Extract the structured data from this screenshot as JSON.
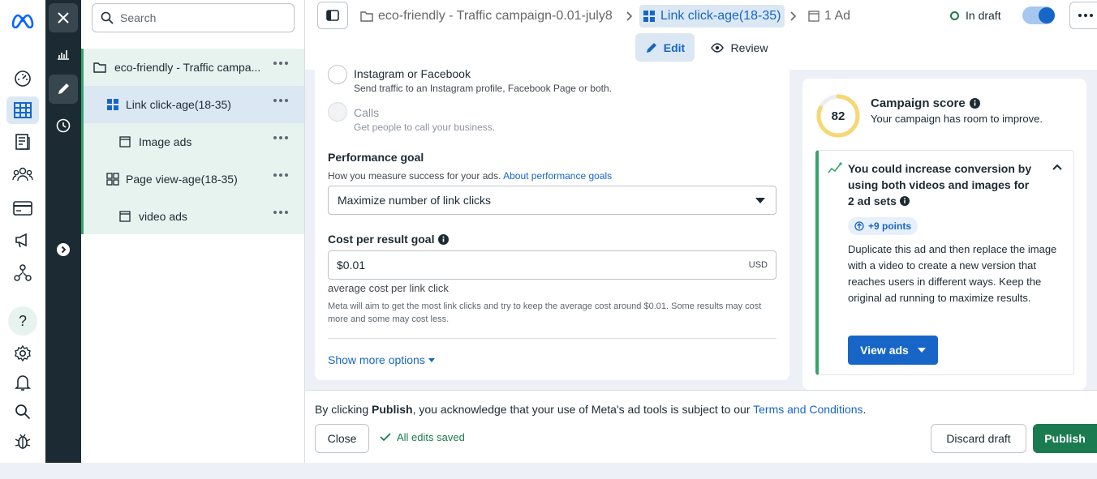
{
  "sidebar_search": {
    "placeholder": "Search"
  },
  "tree": {
    "campaign": "eco-friendly - Traffic campa...",
    "adset1": "Link click-age(18-35)",
    "ad1": "Image ads",
    "adset2": "Page view-age(18-35)",
    "ad2": "video ads"
  },
  "breadcrumb": {
    "campaign": "eco-friendly - Traffic campaign-0.01-july8",
    "adset": "Link click-age(18-35)",
    "ads": "1 Ad"
  },
  "status": {
    "label": "In draft"
  },
  "tabs": {
    "edit": "Edit",
    "review": "Review"
  },
  "form": {
    "option_ig_fb": {
      "title": "Instagram or Facebook",
      "desc": "Send traffic to an Instagram profile, Facebook Page or both."
    },
    "option_calls": {
      "title": "Calls",
      "desc": "Get people to call your business."
    },
    "perf_goal": {
      "title": "Performance goal",
      "desc": "How you measure success for your ads.",
      "link": "About performance goals",
      "value": "Maximize number of link clicks"
    },
    "cost_goal": {
      "title": "Cost per result goal",
      "value": "$0.01",
      "currency": "USD",
      "sub": "average cost per link click",
      "note": "Meta will aim to get the most link clicks and try to keep the average cost around $0.01. Some results may cost more and some may cost less."
    },
    "show_more": "Show more options"
  },
  "score": {
    "value": "82",
    "value_fraction": 0.82,
    "title": "Campaign score",
    "subtitle": "Your campaign has room to improve.",
    "rec_title": "You could increase conversion by using both videos and images for 2 ad sets",
    "points": "+9 points",
    "rec_body": "Duplicate this ad and then replace the image with a video to create a new version that reaches users in different ways. Keep the original ad running to maximize results.",
    "view_ads": "View ads"
  },
  "footer": {
    "pre": "By clicking ",
    "bold": "Publish",
    "mid": ", you acknowledge that your use of Meta's ad tools is subject to our ",
    "link": "Terms and Conditions",
    "end": ".",
    "close": "Close",
    "saved": "All edits saved",
    "discard": "Discard draft",
    "publish": "Publish"
  },
  "colors": {
    "accent": "#1766c7",
    "publish": "#1b7b50",
    "nav_dark": "#1c2b33",
    "tree_bg": "#e7f3ee",
    "tree_selected": "#dbe8f3",
    "score_ring": "#f7d774",
    "saved": "#1b7b50"
  },
  "icons": {
    "far_nav": [
      "meta-logo",
      "dashboard-icon",
      "ads-manager-icon",
      "pages-icon",
      "audiences-icon",
      "billing-icon",
      "campaign-icon",
      "business-icon",
      "help-icon",
      "settings-icon",
      "notifications-icon",
      "search-icon",
      "debug-icon"
    ],
    "dark_nav": [
      "close-icon",
      "chart-icon",
      "edit-icon",
      "history-icon",
      "expand-icon"
    ]
  }
}
